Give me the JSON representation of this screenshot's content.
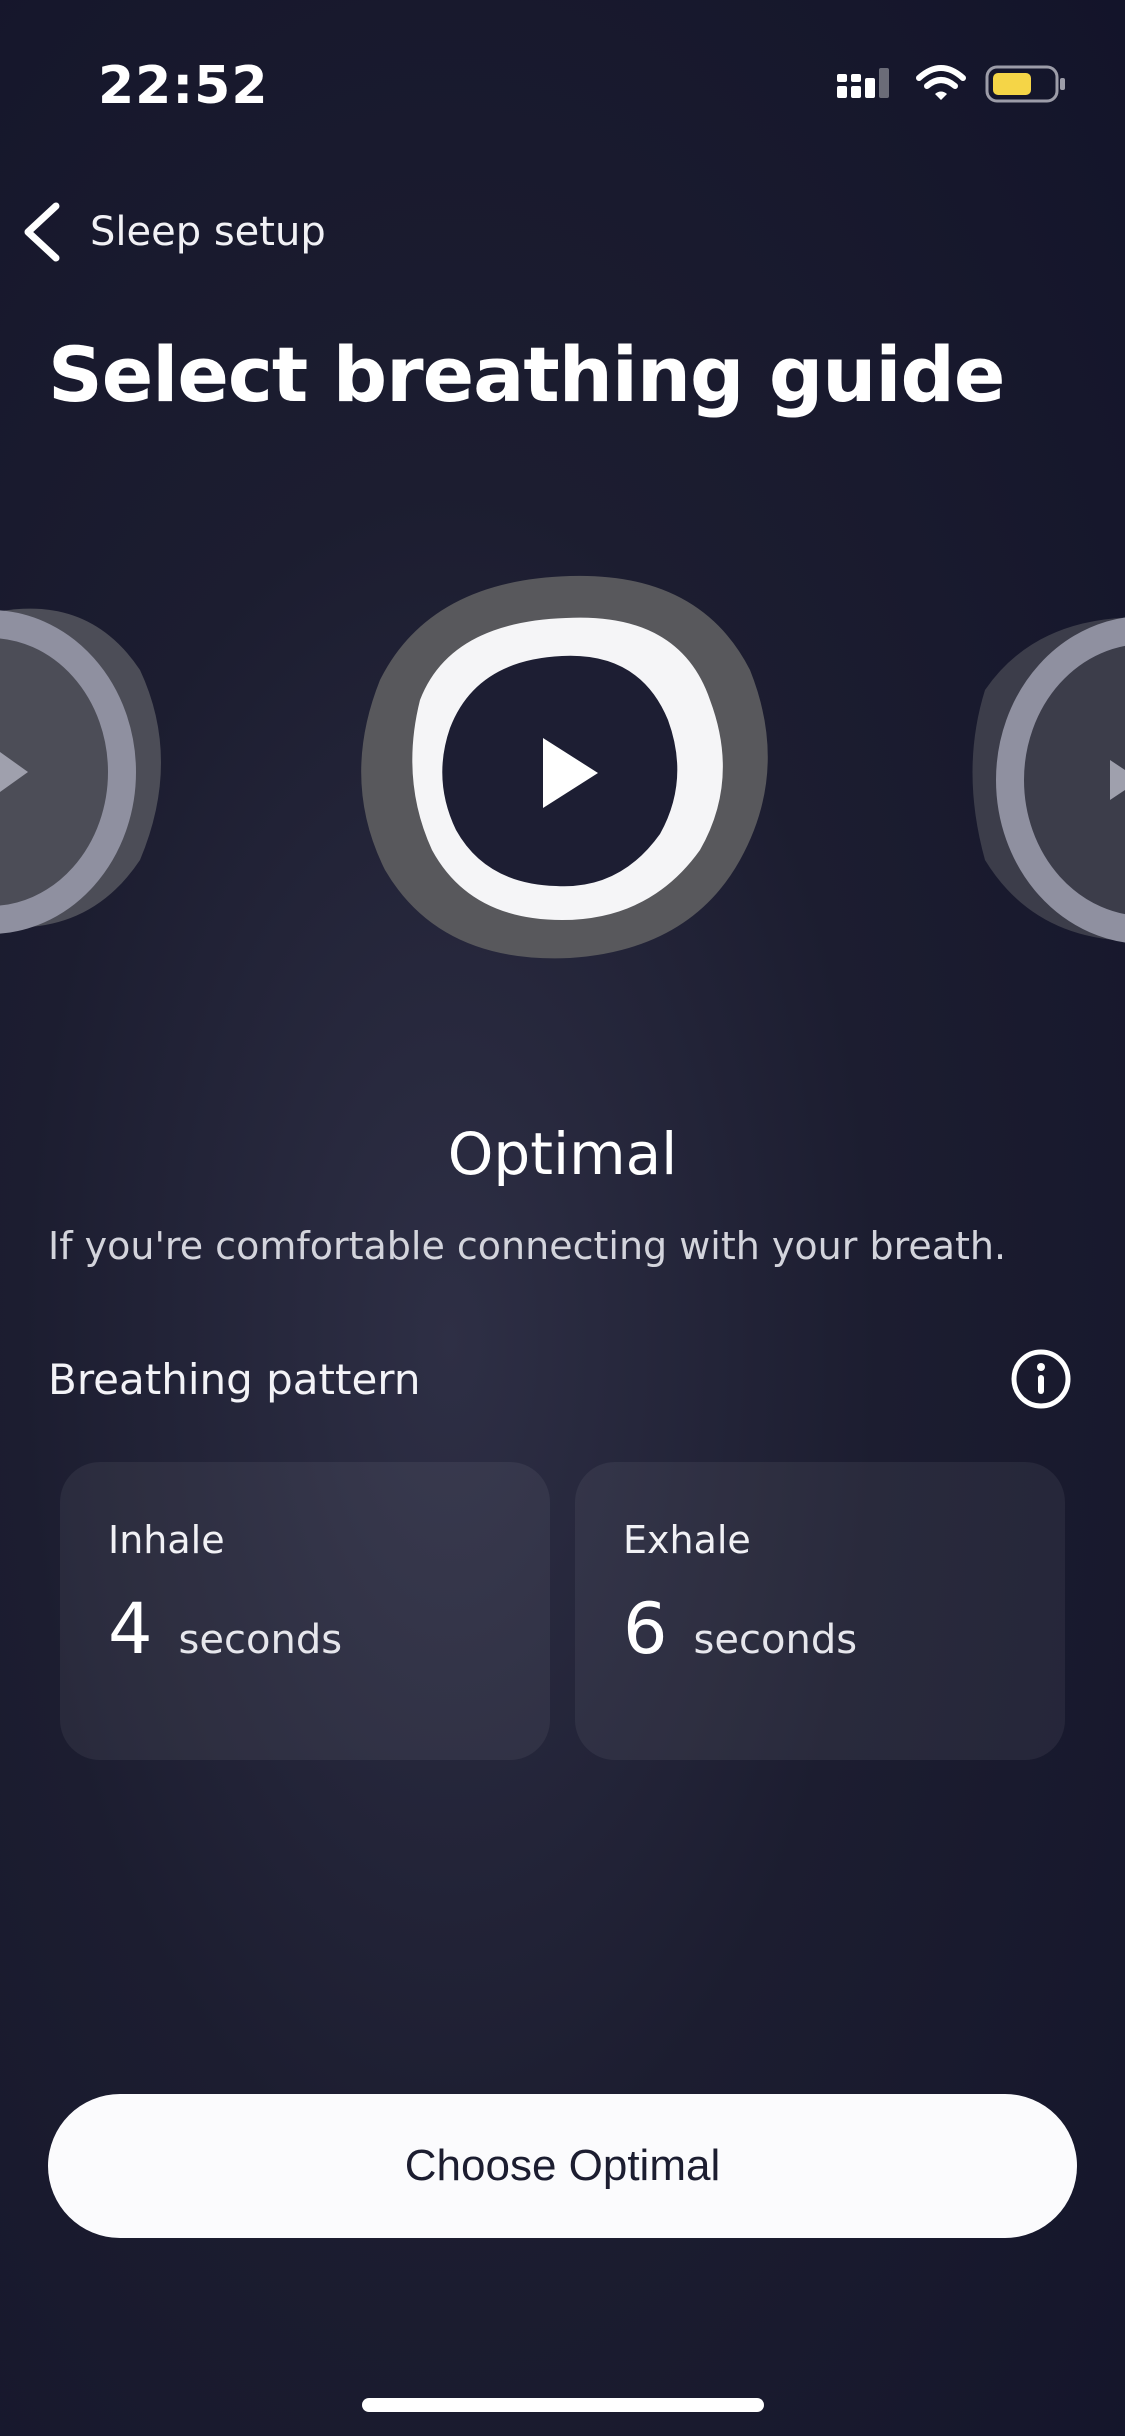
{
  "status_bar": {
    "time": "22:52",
    "icons": [
      "cellular-signal-icon",
      "wifi-icon",
      "battery-icon"
    ],
    "battery_color": "#f5d547"
  },
  "nav": {
    "back_label": "Sleep setup"
  },
  "title": "Select breathing guide",
  "carousel": {
    "items": [
      "previous-guide",
      "Optimal",
      "next-guide"
    ],
    "selected": "Optimal"
  },
  "guide": {
    "name": "Optimal",
    "description": "If you're comfortable connecting with your breath."
  },
  "pattern": {
    "label": "Breathing pattern",
    "inhale": {
      "label": "Inhale",
      "value": "4",
      "unit": "seconds"
    },
    "exhale": {
      "label": "Exhale",
      "value": "6",
      "unit": "seconds"
    }
  },
  "cta": {
    "label": "Choose Optimal"
  },
  "colors": {
    "background": "#1c1d30",
    "button": "#fbfbfd",
    "ring_outer": "#5a5a5e",
    "ring_inner": "#f5f5f7"
  }
}
